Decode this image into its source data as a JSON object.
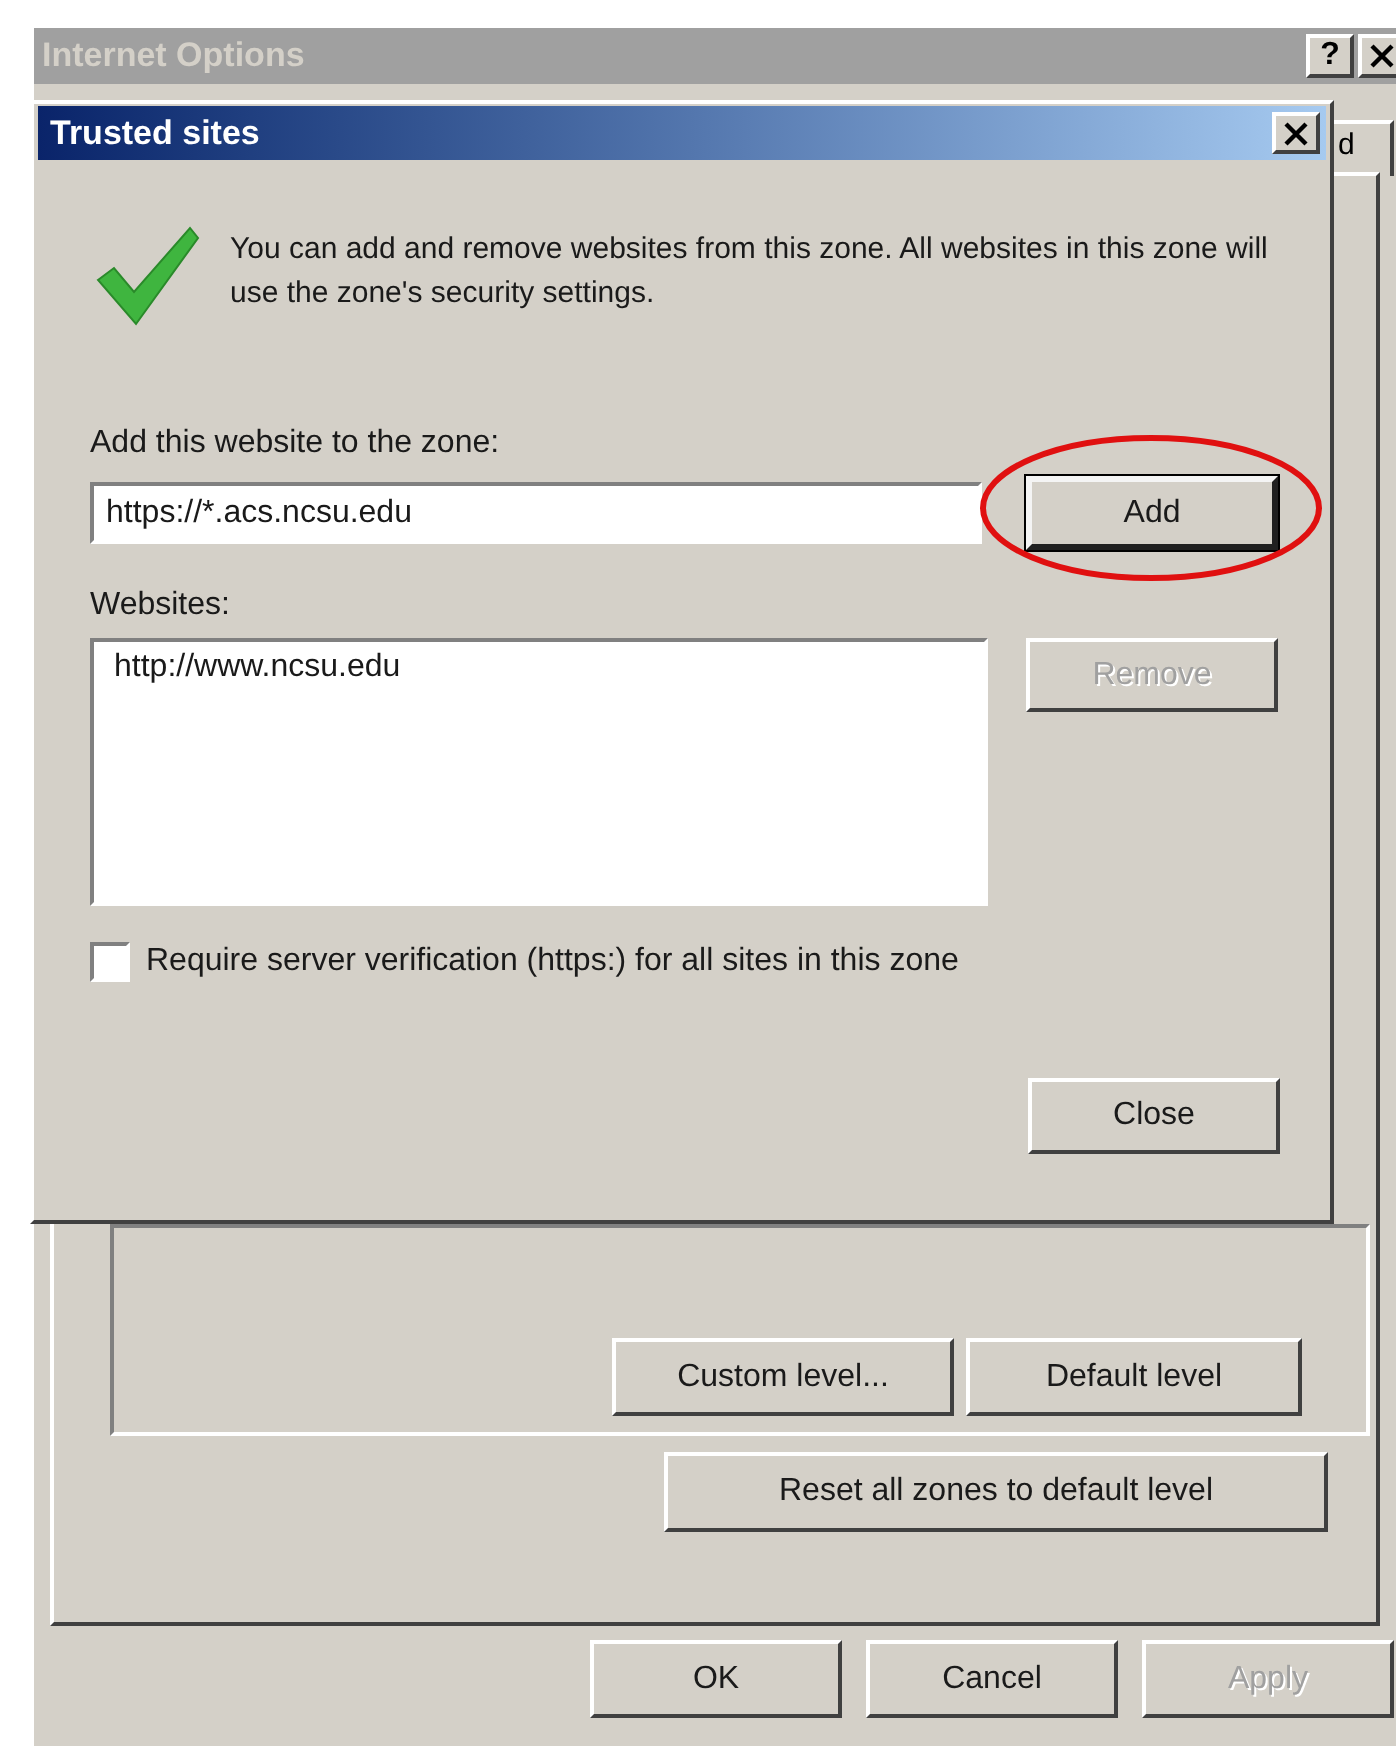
{
  "main_window": {
    "title": "Internet Options",
    "active": false,
    "help_button": "?",
    "tab_fragment": "d",
    "zone_buttons": [
      {
        "label": "Custom level...",
        "disabled": false
      },
      {
        "label": "Default level",
        "disabled": false
      }
    ],
    "reset_button": {
      "label": "Reset all zones to default level",
      "disabled": false
    },
    "footer_buttons": [
      {
        "label": "OK",
        "disabled": false
      },
      {
        "label": "Cancel",
        "disabled": false
      },
      {
        "label": "Apply",
        "disabled": true
      }
    ]
  },
  "dialog": {
    "title": "Trusted sites",
    "active": true,
    "info_text": "You can add and remove websites from this zone. All websites in this zone will use the zone's security settings.",
    "add_label": "Add this website to the zone:",
    "add_value": "https://*.acs.ncsu.edu",
    "add_button": {
      "label": "Add",
      "disabled": false,
      "default": true,
      "highlighted": true
    },
    "websites_label": "Websites:",
    "websites": [
      {
        "label": "http://www.ncsu.edu",
        "selected": false
      }
    ],
    "remove_button": {
      "label": "Remove",
      "disabled": true
    },
    "require_https": {
      "label": "Require server verification (https:) for all sites in this zone",
      "checked": false
    },
    "close_button": {
      "label": "Close",
      "disabled": false
    }
  }
}
